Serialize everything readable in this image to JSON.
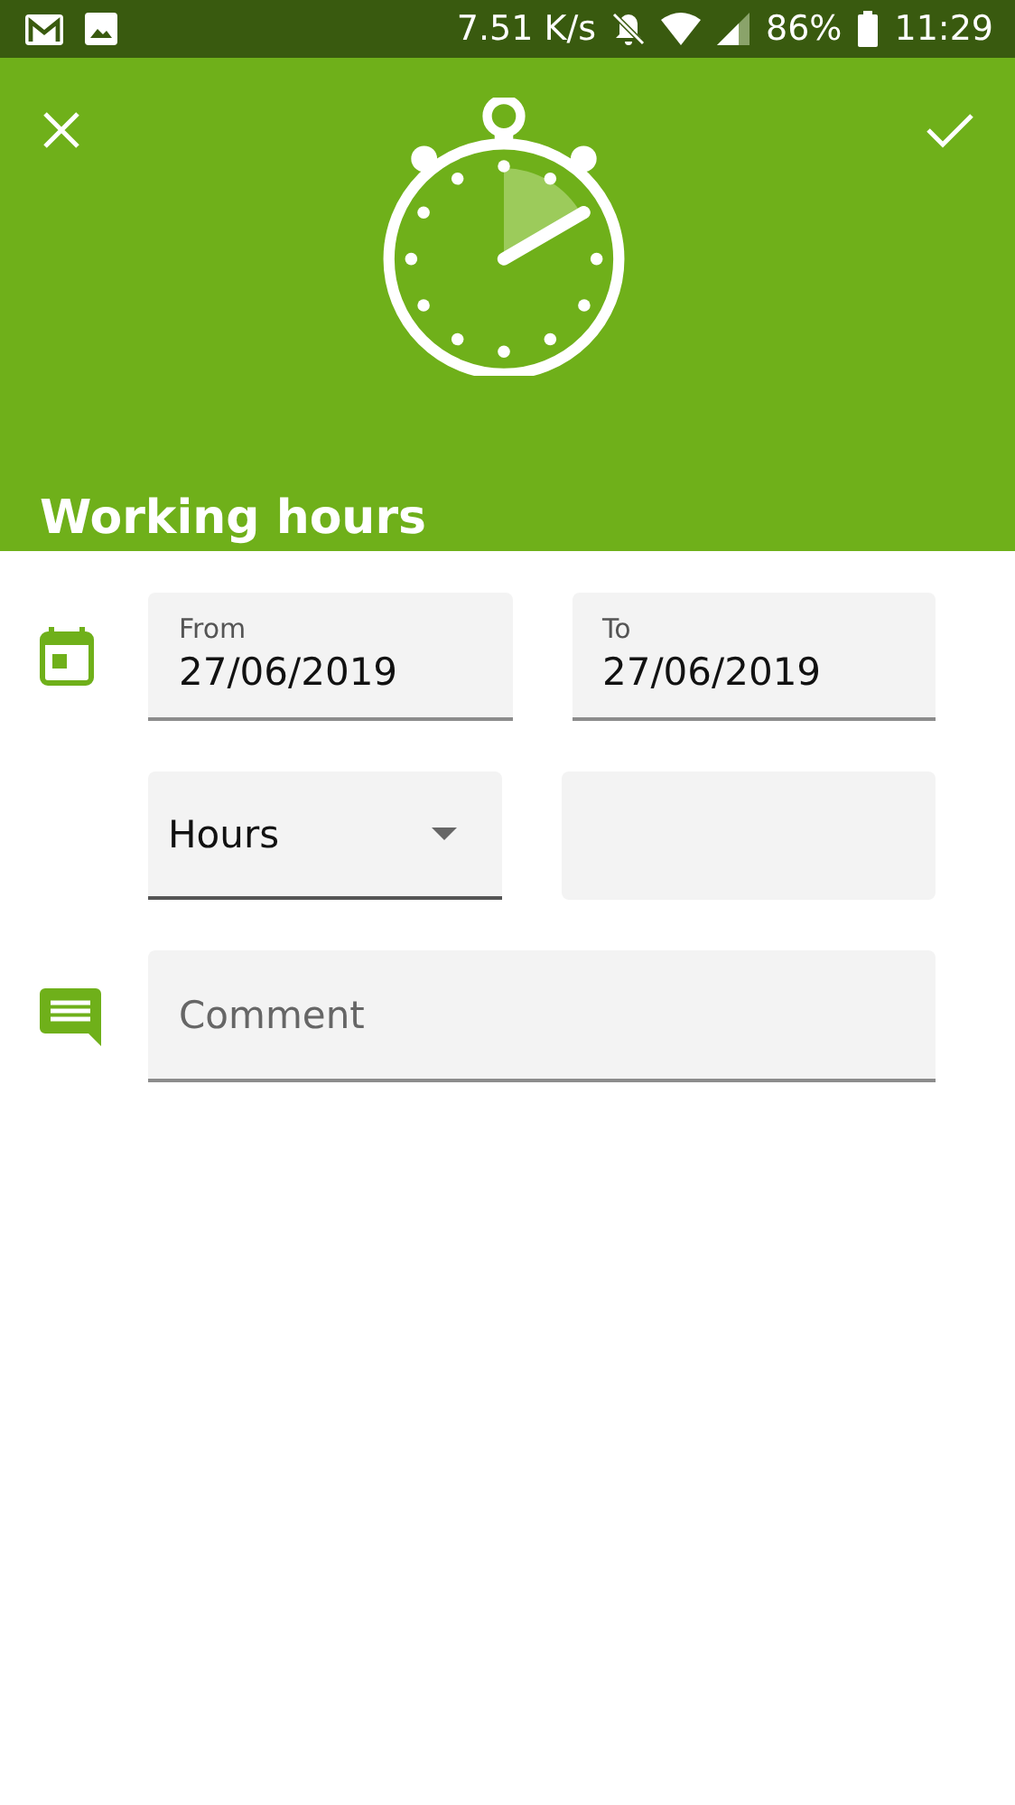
{
  "status_bar": {
    "speed": "7.51 K/s",
    "battery": "86%",
    "time": "11:29"
  },
  "header": {
    "title": "Working hours"
  },
  "rows": [
    {
      "fields": [
        {
          "kind": "date",
          "label": "From",
          "value": "27/06/2019"
        },
        {
          "kind": "date",
          "label": "To",
          "value": "27/06/2019"
        }
      ]
    },
    {
      "fields": [
        {
          "kind": "select",
          "value": "Hours"
        },
        {
          "kind": "blank"
        }
      ]
    },
    {
      "fields": [
        {
          "kind": "text",
          "placeholder": "Comment"
        }
      ]
    }
  ]
}
